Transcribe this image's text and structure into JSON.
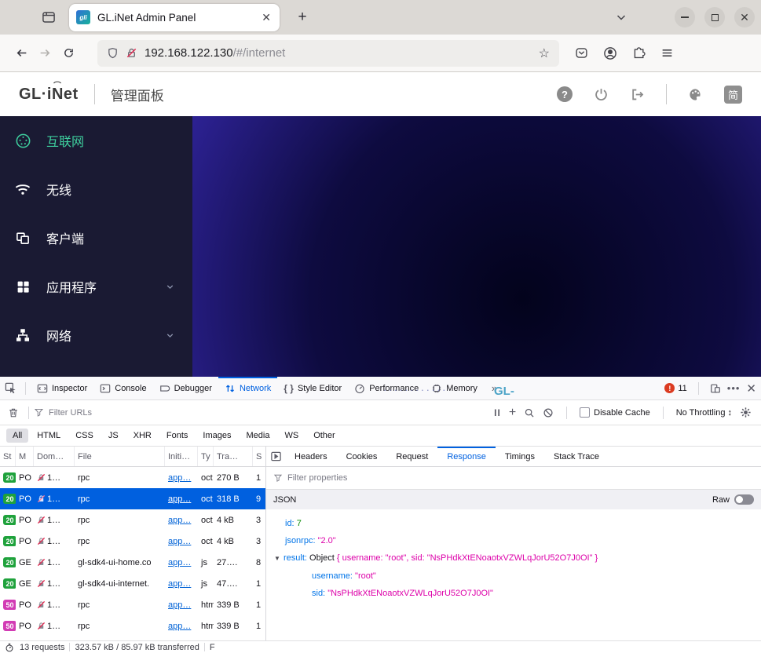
{
  "browser": {
    "tab": {
      "title": "GL.iNet Admin Panel",
      "favicon_text": "gli"
    },
    "url": {
      "host": "192.168.122.130",
      "path": "/#/internet"
    }
  },
  "header": {
    "logo": "GL·iNet",
    "title": "管理面板",
    "lang_badge": "简"
  },
  "sidebar": {
    "items": [
      {
        "label": "互联网",
        "active": true
      },
      {
        "label": "无线"
      },
      {
        "label": "客户端"
      },
      {
        "label": "应用程序",
        "expandable": true
      },
      {
        "label": "网络",
        "expandable": true
      }
    ]
  },
  "main": {
    "dots": "············",
    "device_label": "GL-"
  },
  "devtools": {
    "tabs": [
      "Inspector",
      "Console",
      "Debugger",
      "Network",
      "Style Editor",
      "Performance",
      "Memory"
    ],
    "active_tab": "Network",
    "error_count": "11",
    "netbar": {
      "filter_placeholder": "Filter URLs",
      "disable_cache_label": "Disable Cache",
      "throttling_label": "No Throttling"
    },
    "type_filters": [
      "All",
      "HTML",
      "CSS",
      "JS",
      "XHR",
      "Fonts",
      "Images",
      "Media",
      "WS",
      "Other"
    ],
    "active_type_filter": "All",
    "table": {
      "headers": [
        "St",
        "M",
        "Dom…",
        "File",
        "Initi…",
        "Ty",
        "Tra…",
        "S"
      ],
      "rows": [
        {
          "status": "20",
          "method": "PO",
          "domain": "1…",
          "file": "rpc",
          "initiator": "app…",
          "type": "oct",
          "transferred": "270 B",
          "size": "1"
        },
        {
          "status": "20",
          "method": "PO",
          "domain": "1…",
          "file": "rpc",
          "initiator": "app…",
          "type": "oct",
          "transferred": "318 B",
          "size": "9",
          "selected": true
        },
        {
          "status": "20",
          "method": "PO",
          "domain": "1…",
          "file": "rpc",
          "initiator": "app…",
          "type": "oct",
          "transferred": "4 kB",
          "size": "3"
        },
        {
          "status": "20",
          "method": "PO",
          "domain": "1…",
          "file": "rpc",
          "initiator": "app…",
          "type": "oct",
          "transferred": "4 kB",
          "size": "3"
        },
        {
          "status": "20",
          "method": "GE",
          "domain": "1…",
          "file": "gl-sdk4-ui-home.co",
          "initiator": "app…",
          "type": "js",
          "transferred": "27….",
          "size": "8"
        },
        {
          "status": "20",
          "method": "GE",
          "domain": "1…",
          "file": "gl-sdk4-ui-internet.",
          "initiator": "app…",
          "type": "js",
          "transferred": "47….",
          "size": "1"
        },
        {
          "status": "50",
          "method": "PO",
          "domain": "1…",
          "file": "rpc",
          "initiator": "app…",
          "type": "htm",
          "transferred": "339 B",
          "size": "1"
        },
        {
          "status": "50",
          "method": "PO",
          "domain": "1…",
          "file": "rpc",
          "initiator": "app…",
          "type": "htm",
          "transferred": "339 B",
          "size": "1"
        }
      ]
    },
    "detail": {
      "tabs": [
        "Headers",
        "Cookies",
        "Request",
        "Response",
        "Timings",
        "Stack Trace"
      ],
      "active_tab": "Response",
      "filter_placeholder": "Filter properties",
      "json_label": "JSON",
      "raw_label": "Raw",
      "tree": {
        "id_key": "id:",
        "id_value": "7",
        "jsonrpc_key": "jsonrpc:",
        "jsonrpc_value": "\"2.0\"",
        "result_key": "result:",
        "result_object": "Object",
        "result_preview": "{ username: \"root\", sid: \"NsPHdkXtENoaotxVZWLqJorU52O7J0OI\" }",
        "username_key": "username:",
        "username_value": "\"root\"",
        "sid_key": "sid:",
        "sid_value": "\"NsPHdkXtENoaotxVZWLqJorU52O7J0OI\""
      }
    },
    "statusbar": {
      "requests": "13 requests",
      "transferred": "323.57 kB / 85.97 kB transferred",
      "finish": "F"
    }
  },
  "colors": {
    "accent_blue": "#0061e0",
    "sidebar_bg": "#1a1a33",
    "sidebar_active": "#3ecf9e",
    "status_200": "#1fa23c",
    "status_500": "#d23cb4",
    "selected_row": "#0060df",
    "json_key": "#0074e8",
    "json_number": "#058b00",
    "json_string": "#dd00a9",
    "error_badge": "#db3b21",
    "device_label": "#4ba3c7"
  }
}
